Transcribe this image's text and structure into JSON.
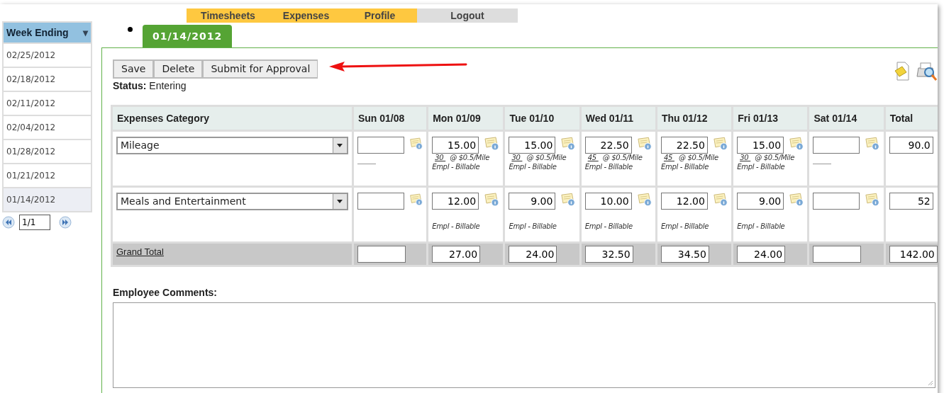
{
  "nav": [
    {
      "label": "Timesheets",
      "kind": "section"
    },
    {
      "label": "Expenses",
      "kind": "section"
    },
    {
      "label": "Profile",
      "kind": "section"
    },
    {
      "label": "Logout",
      "kind": "logout"
    }
  ],
  "sidebar": {
    "header": "Week Ending",
    "caret": "▾",
    "items": [
      {
        "label": "02/25/2012",
        "selected": false
      },
      {
        "label": "02/18/2012",
        "selected": false
      },
      {
        "label": "02/11/2012",
        "selected": false
      },
      {
        "label": "02/04/2012",
        "selected": false
      },
      {
        "label": "01/28/2012",
        "selected": false
      },
      {
        "label": "01/21/2012",
        "selected": false
      },
      {
        "label": "01/14/2012",
        "selected": true
      }
    ],
    "pager": "1/1"
  },
  "tabs": [
    {
      "label": "01/14/2012",
      "selected": true
    }
  ],
  "buttons": [
    "Save",
    "Delete",
    "Submit for Approval"
  ],
  "status": {
    "label": "Status:",
    "value": "Entering"
  },
  "table": {
    "columns": [
      "Expenses Category",
      "Sun 01/08",
      "Mon 01/09",
      "Tue 01/10",
      "Wed 01/11",
      "Thu 01/12",
      "Fri 01/13",
      "Sat 01/14",
      "Total"
    ],
    "rows": [
      {
        "cells": [
          {
            "kind": "category",
            "value": "Mileage"
          },
          {
            "kind": "blank-line"
          },
          {
            "kind": "mileage",
            "value": "15.00",
            "qty": "30",
            "rate": "@ $0.5/Mile",
            "type": "Empl - Billable"
          },
          {
            "kind": "mileage",
            "value": "15.00",
            "qty": "30",
            "rate": "@ $0.5/Mile",
            "type": "Empl - Billable"
          },
          {
            "kind": "mileage",
            "value": "22.50",
            "qty": "45",
            "rate": "@ $0.5/Mile",
            "type": "Empl - Billable"
          },
          {
            "kind": "mileage",
            "value": "22.50",
            "qty": "45",
            "rate": "@ $0.5/Mile",
            "type": "Empl - Billable"
          },
          {
            "kind": "mileage",
            "value": "15.00",
            "qty": "30",
            "rate": "@ $0.5/Mile",
            "type": "Empl - Billable"
          },
          {
            "kind": "blank-line"
          },
          {
            "kind": "total",
            "value": "90.0"
          }
        ]
      },
      {
        "cells": [
          {
            "kind": "category",
            "value": "Meals and Entertainment"
          },
          {
            "kind": "empty"
          },
          {
            "kind": "basic",
            "value": "12.00",
            "type": "Empl - Billable"
          },
          {
            "kind": "basic",
            "value": "9.00",
            "type": "Empl - Billable"
          },
          {
            "kind": "basic",
            "value": "10.00",
            "type": "Empl - Billable"
          },
          {
            "kind": "basic",
            "value": "12.00",
            "type": "Empl - Billable"
          },
          {
            "kind": "basic",
            "value": "9.00",
            "type": "Empl - Billable"
          },
          {
            "kind": "empty"
          },
          {
            "kind": "total",
            "value": "52"
          }
        ]
      },
      {
        "cells": [
          {
            "kind": "grand-total-link",
            "value": "Grand Total"
          },
          {
            "kind": "grand-total"
          },
          {
            "kind": "grand-total",
            "value": "27.00"
          },
          {
            "kind": "grand-total",
            "value": "24.00"
          },
          {
            "kind": "grand-total",
            "value": "32.50"
          },
          {
            "kind": "grand-total",
            "value": "34.50"
          },
          {
            "kind": "grand-total",
            "value": "24.00"
          },
          {
            "kind": "grand-total"
          },
          {
            "kind": "grand-total",
            "value": "142.00"
          }
        ]
      }
    ]
  },
  "comments": {
    "label": "Employee Comments:"
  }
}
